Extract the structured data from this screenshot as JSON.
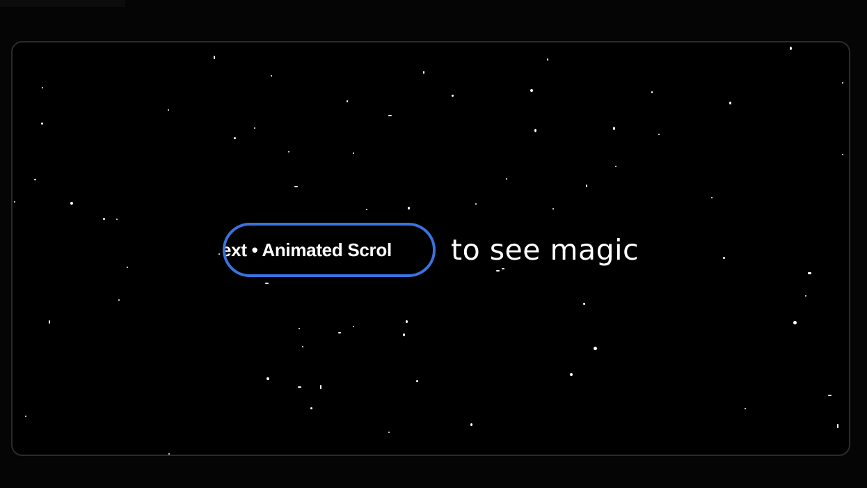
{
  "ticker": {
    "marquee_text": "ext • Animated Scrol"
  },
  "caption": {
    "text": "to see magic"
  },
  "colors": {
    "background": "#000000",
    "frame_border": "#2b2b2b",
    "pill_border": "#3a73e0",
    "text": "#ffffff"
  }
}
